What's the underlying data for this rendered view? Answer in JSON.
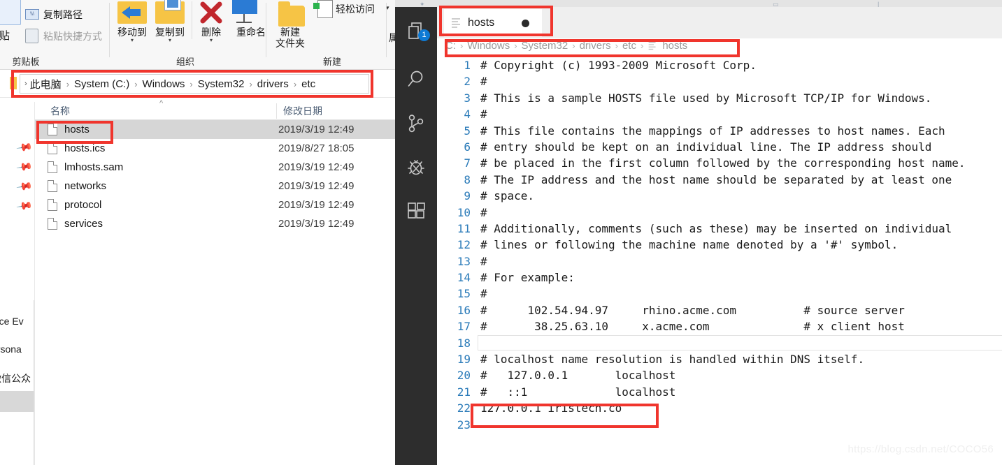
{
  "explorer": {
    "ribbon": {
      "groups": [
        {
          "label": "剪贴板"
        },
        {
          "label": "组织"
        },
        {
          "label": "新建"
        }
      ],
      "clipboard": {
        "paste_label": "粘贴",
        "copy_path_label": "复制路径",
        "paste_shortcut_label": "粘贴快捷方式"
      },
      "organize": {
        "move_to_label": "移动到",
        "copy_to_label": "复制到",
        "delete_label": "删除",
        "rename_label": "重命名"
      },
      "new": {
        "new_folder_label": "新建\n文件夹",
        "new_folder_line1": "新建",
        "new_folder_line2": "文件夹",
        "easy_access_label": "轻松访问"
      },
      "open": {
        "properties_label": "属性"
      }
    },
    "address_bar": {
      "breadcrumbs": [
        "此电脑",
        "System (C:)",
        "Windows",
        "System32",
        "drivers",
        "etc"
      ],
      "separator": "›"
    },
    "columns": {
      "name": "名称",
      "date_modified": "修改日期",
      "sort_caret": "⌃"
    },
    "files": [
      {
        "name": "hosts",
        "date": "2019/3/19 12:49",
        "selected": true
      },
      {
        "name": "hosts.ics",
        "date": "2019/8/27 18:05",
        "selected": false
      },
      {
        "name": "lmhosts.sam",
        "date": "2019/3/19 12:49",
        "selected": false
      },
      {
        "name": "networks",
        "date": "2019/3/19 12:49",
        "selected": false
      },
      {
        "name": "protocol",
        "date": "2019/3/19 12:49",
        "selected": false
      },
      {
        "name": "services",
        "date": "2019/3/19 12:49",
        "selected": false
      }
    ],
    "edge_labels": [
      "ffice Ev",
      "ersona",
      "微信公众"
    ]
  },
  "vscode": {
    "activity_bar": {
      "items": [
        {
          "icon": "files-explorer-icon",
          "badge": "1"
        },
        {
          "icon": "search-icon",
          "badge": ""
        },
        {
          "icon": "source-control-icon",
          "badge": ""
        },
        {
          "icon": "debug-icon",
          "badge": ""
        },
        {
          "icon": "extensions-icon",
          "badge": ""
        }
      ]
    },
    "tab": {
      "label": "hosts",
      "icon": "text-file-icon",
      "dirty": true
    },
    "breadcrumbs": [
      "C:",
      "Windows",
      "System32",
      "drivers",
      "etc",
      "hosts"
    ],
    "breadcrumb_separator": "›",
    "editor": {
      "lines": [
        {
          "n": "1",
          "text": "# Copyright (c) 1993-2009 Microsoft Corp."
        },
        {
          "n": "2",
          "text": "#"
        },
        {
          "n": "3",
          "text": "# This is a sample HOSTS file used by Microsoft TCP/IP for Windows."
        },
        {
          "n": "4",
          "text": "#"
        },
        {
          "n": "5",
          "text": "# This file contains the mappings of IP addresses to host names. Each"
        },
        {
          "n": "6",
          "text": "# entry should be kept on an individual line. The IP address should"
        },
        {
          "n": "7",
          "text": "# be placed in the first column followed by the corresponding host name."
        },
        {
          "n": "8",
          "text": "# The IP address and the host name should be separated by at least one"
        },
        {
          "n": "9",
          "text": "# space."
        },
        {
          "n": "10",
          "text": "#"
        },
        {
          "n": "11",
          "text": "# Additionally, comments (such as these) may be inserted on individual"
        },
        {
          "n": "12",
          "text": "# lines or following the machine name denoted by a '#' symbol."
        },
        {
          "n": "13",
          "text": "#"
        },
        {
          "n": "14",
          "text": "# For example:"
        },
        {
          "n": "15",
          "text": "#"
        },
        {
          "n": "16",
          "text": "#      102.54.94.97     rhino.acme.com          # source server"
        },
        {
          "n": "17",
          "text": "#       38.25.63.10     x.acme.com              # x client host"
        },
        {
          "n": "18",
          "text": "",
          "current": true
        },
        {
          "n": "19",
          "text": "# localhost name resolution is handled within DNS itself."
        },
        {
          "n": "20",
          "text": "#   127.0.0.1       localhost"
        },
        {
          "n": "21",
          "text": "#   ::1             localhost"
        },
        {
          "n": "22",
          "text": "127.0.0.1 iristech.co"
        },
        {
          "n": "23",
          "text": ""
        }
      ]
    }
  },
  "annotations": {
    "color": "#f0352d",
    "regions": [
      "explorer-address-bar",
      "explorer-hosts-row",
      "vscode-tab",
      "vscode-breadcrumbs",
      "vscode-line-22"
    ]
  },
  "watermark": "https://blog.csdn.net/COCO56"
}
